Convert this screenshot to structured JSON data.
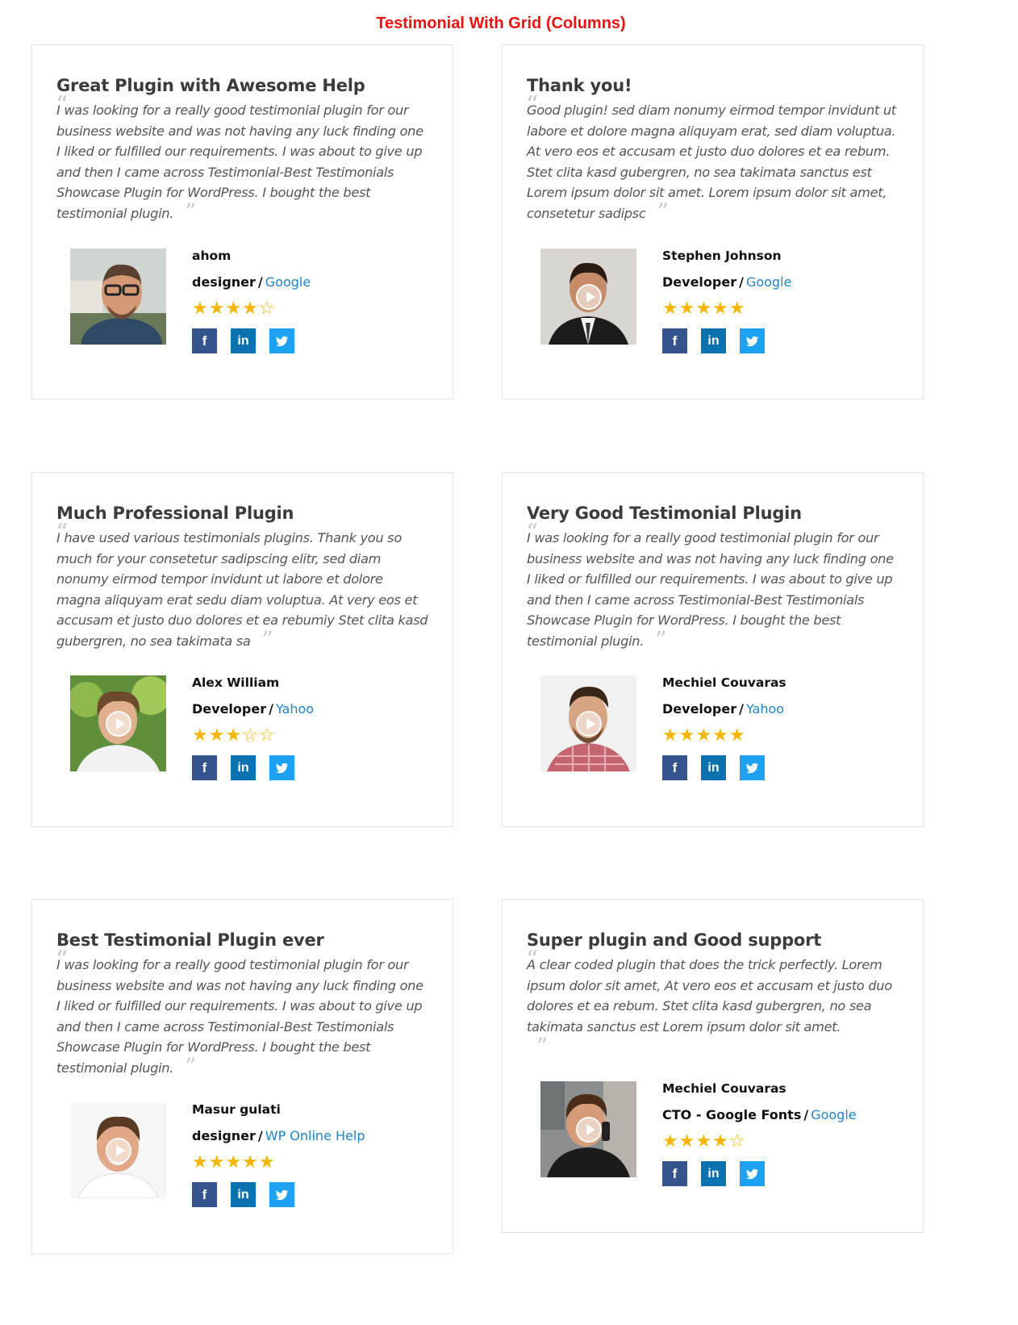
{
  "page": {
    "title": "Testimonial With Grid (Columns)"
  },
  "colors": {
    "title_red": "#ee1111",
    "company_link": "#1e84c8",
    "star": "#f5b500",
    "facebook": "#35538f",
    "linkedin": "#0b72b0",
    "twitter": "#1da1f2"
  },
  "social": {
    "facebook": "f",
    "linkedin": "in",
    "twitter": "🐦"
  },
  "cards": [
    {
      "title": "Great Plugin with Awesome Help",
      "quote": "I was looking for a really good testimonial plugin for our business website and was not having any luck finding one I liked or fulfilled our requirements. I was about to give up and then I came across Testimonial-Best Testimonials Showcase Plugin for WordPress. I bought the best testimonial plugin.",
      "name": "ahom",
      "designation": "designer",
      "company": "Google",
      "rating": 4,
      "has_video": false,
      "stars": "★★★★☆"
    },
    {
      "title": "Thank you!",
      "quote": "Good plugin! sed diam nonumy eirmod tempor invidunt ut labore et dolore magna aliquyam erat, sed diam voluptua. At vero eos et accusam et justo duo dolores et ea rebum. Stet clita kasd gubergren, no sea takimata sanctus est Lorem ipsum dolor sit amet. Lorem ipsum dolor sit amet, consetetur sadipsc",
      "name": "Stephen Johnson",
      "designation": "Developer",
      "company": "Google",
      "rating": 5,
      "has_video": true,
      "stars": "★★★★★"
    },
    {
      "title": "Much Professional Plugin",
      "quote": "I have used various testimonials plugins. Thank you so much for your consetetur sadipscing elitr, sed diam nonumy eirmod tempor invidunt ut labore et dolore magna aliquyam erat sedu diam voluptua. At very eos et accusam et justo duo dolores et ea rebumiy Stet clita kasd gubergren, no sea takimata sa",
      "name": "Alex William",
      "designation": "Developer",
      "company": "Yahoo",
      "rating": 3,
      "has_video": true,
      "stars": "★★★☆☆"
    },
    {
      "title": "Very Good Testimonial Plugin",
      "quote": "I was looking for a really good testimonial plugin for our business website and was not having any luck finding one I liked or fulfilled our requirements. I was about to give up and then I came across Testimonial-Best Testimonials Showcase Plugin for WordPress. I bought the best testimonial plugin.",
      "name": "Mechiel Couvaras",
      "designation": "Developer",
      "company": "Yahoo",
      "rating": 5,
      "has_video": true,
      "stars": "★★★★★"
    },
    {
      "title": "Best Testimonial Plugin ever",
      "quote": "I was looking for a really good testimonial plugin for our business website and was not having any luck finding one I liked or fulfilled our requirements. I was about to give up and then I came across Testimonial-Best Testimonials Showcase Plugin for WordPress. I bought the best testimonial plugin.",
      "name": "Masur gulati",
      "designation": "designer",
      "company": "WP Online Help",
      "rating": 5,
      "has_video": true,
      "stars": "★★★★★"
    },
    {
      "title": "Super plugin and Good support",
      "quote": "A clear coded plugin that does the trick perfectly. Lorem ipsum dolor sit amet, At vero eos et accusam et justo duo dolores et ea rebum. Stet clita kasd gubergren, no sea takimata sanctus est Lorem ipsum dolor sit amet.",
      "name": "Mechiel Couvaras",
      "designation": "CTO - Google Fonts",
      "company": "Google",
      "rating": 4,
      "has_video": true,
      "stars": "★★★★☆"
    }
  ]
}
